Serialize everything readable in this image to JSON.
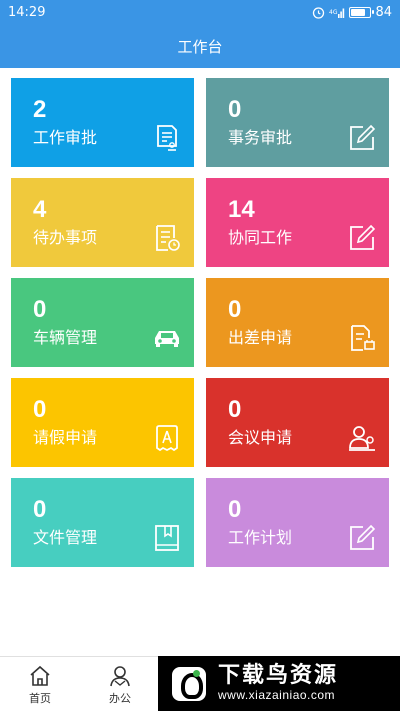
{
  "status_bar": {
    "time": "14:29",
    "battery": "84",
    "battery_fraction": 0.84
  },
  "header": {
    "title": "工作台"
  },
  "tiles": [
    {
      "count": "2",
      "label": "工作审批",
      "color": "#0fa0e6",
      "icon": "approval-doc-icon"
    },
    {
      "count": "0",
      "label": "事务审批",
      "color": "#5f9ea0",
      "icon": "edit-icon"
    },
    {
      "count": "4",
      "label": "待办事项",
      "color": "#f0c93c",
      "icon": "todo-list-icon"
    },
    {
      "count": "14",
      "label": "协同工作",
      "color": "#ee4483",
      "icon": "edit-icon"
    },
    {
      "count": "0",
      "label": "车辆管理",
      "color": "#49c77f",
      "icon": "car-icon"
    },
    {
      "count": "0",
      "label": "出差申请",
      "color": "#ec971f",
      "icon": "business-trip-doc-icon"
    },
    {
      "count": "0",
      "label": "请假申请",
      "color": "#fcc500",
      "icon": "leave-form-icon"
    },
    {
      "count": "0",
      "label": "会议申请",
      "color": "#d9322c",
      "icon": "meeting-person-icon"
    },
    {
      "count": "0",
      "label": "文件管理",
      "color": "#47cec0",
      "icon": "file-book-icon"
    },
    {
      "count": "0",
      "label": "工作计划",
      "color": "#c98bdc",
      "icon": "edit-icon"
    }
  ],
  "bottom_nav": [
    {
      "label": "首页",
      "icon": "home-icon"
    },
    {
      "label": "办公",
      "icon": "office-icon"
    }
  ],
  "watermark": {
    "title": "下载鸟资源",
    "url": "www.xiazainiao.com"
  }
}
